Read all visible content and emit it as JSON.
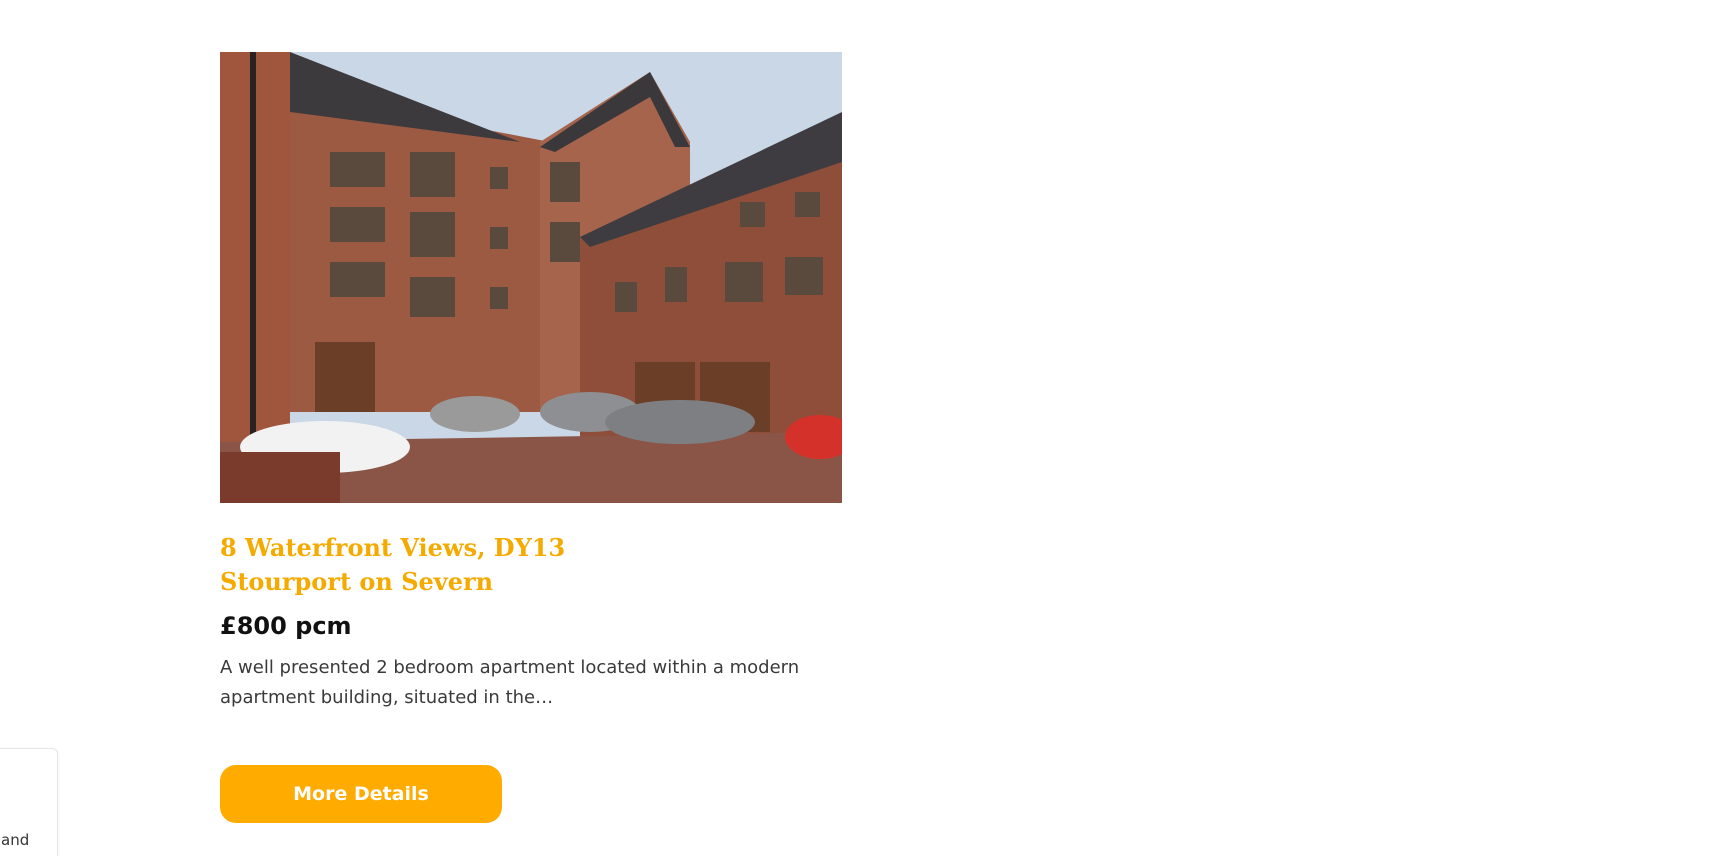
{
  "listing": {
    "image_alt": "Brick apartment building with parked cars",
    "title_line1": "8 Waterfront Views, DY13",
    "title_line2": "Stourport on Severn",
    "price": "£800 pcm",
    "description": "A well presented 2 bedroom apartment located within a modern apartment building, situated in the…",
    "button_label": "More Details"
  },
  "side_widget": {
    "text": "and"
  },
  "colors": {
    "accent": "#ffab00",
    "title": "#f5aa00"
  }
}
